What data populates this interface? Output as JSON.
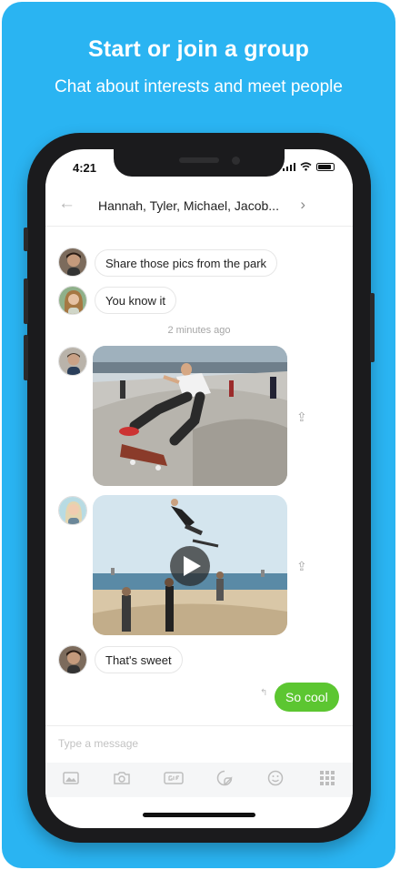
{
  "promo": {
    "headline": "Start or join a group",
    "subline": "Chat about interests and meet people"
  },
  "status_bar": {
    "time": "4:21"
  },
  "chat": {
    "back_icon": "back-arrow-icon",
    "title": "Hannah, Tyler, Michael, Jacob...",
    "chevron": "›"
  },
  "messages": [
    {
      "text": "Share those pics from the park"
    },
    {
      "text": "You know it"
    }
  ],
  "timestamp": "2 minutes ago",
  "last_incoming": "That's sweet",
  "outgoing": "So cool",
  "composer": {
    "placeholder": "Type a message"
  },
  "toolbar_icons": [
    "gallery-icon",
    "camera-icon",
    "gif-icon",
    "sticker-icon",
    "emoji-icon",
    "apps-grid-icon"
  ],
  "colors": {
    "background": "#2ab4f2",
    "outgoing_bubble": "#5cc631",
    "phone_frame": "#1b1b1d"
  }
}
